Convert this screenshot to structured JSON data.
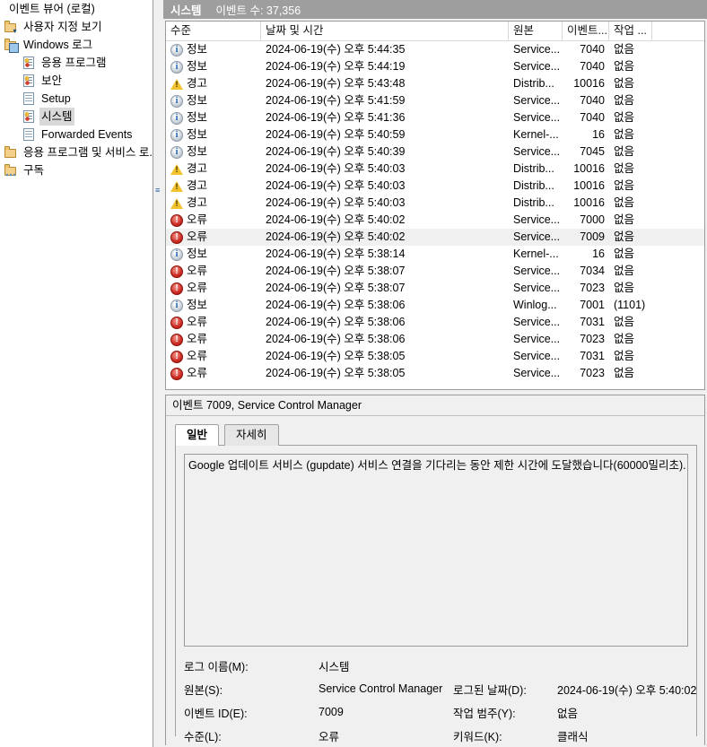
{
  "tree": {
    "items": [
      {
        "label": "이벤트 뷰어 (로컬)",
        "icon": "root-icon",
        "indent": 0,
        "selected": false
      },
      {
        "label": "사용자 지정 보기",
        "icon": "custom-views-icon",
        "indent": 1,
        "selected": false
      },
      {
        "label": "Windows 로그",
        "icon": "windows-logs-icon",
        "indent": 1,
        "selected": false
      },
      {
        "label": "응용 프로그램",
        "icon": "log-alert-icon",
        "indent": 2,
        "selected": false
      },
      {
        "label": "보안",
        "icon": "log-alert-icon",
        "indent": 2,
        "selected": false
      },
      {
        "label": "Setup",
        "icon": "log-icon",
        "indent": 2,
        "selected": false
      },
      {
        "label": "시스템",
        "icon": "log-alert-icon",
        "indent": 2,
        "selected": true
      },
      {
        "label": "Forwarded Events",
        "icon": "log-icon",
        "indent": 2,
        "selected": false
      },
      {
        "label": "응용 프로그램 및 서비스 로.",
        "icon": "app-services-logs-icon",
        "indent": 1,
        "selected": false
      },
      {
        "label": "구독",
        "icon": "subscriptions-icon",
        "indent": 1,
        "selected": false
      }
    ]
  },
  "list": {
    "title": "시스템",
    "count_label": "이벤트 수: 37,356",
    "columns": [
      "수준",
      "날짜 및 시간",
      "원본",
      "이벤트...",
      "작업 ...",
      ""
    ],
    "rows": [
      {
        "level": "정보",
        "level_icon": "information-icon",
        "datetime": "2024-06-19(수) 오후 5:44:35",
        "source": "Service...",
        "event_id": "7040",
        "task": "없음",
        "selected": false
      },
      {
        "level": "정보",
        "level_icon": "information-icon",
        "datetime": "2024-06-19(수) 오후 5:44:19",
        "source": "Service...",
        "event_id": "7040",
        "task": "없음",
        "selected": false
      },
      {
        "level": "경고",
        "level_icon": "warning-icon",
        "datetime": "2024-06-19(수) 오후 5:43:48",
        "source": "Distrib...",
        "event_id": "10016",
        "task": "없음",
        "selected": false
      },
      {
        "level": "정보",
        "level_icon": "information-icon",
        "datetime": "2024-06-19(수) 오후 5:41:59",
        "source": "Service...",
        "event_id": "7040",
        "task": "없음",
        "selected": false
      },
      {
        "level": "정보",
        "level_icon": "information-icon",
        "datetime": "2024-06-19(수) 오후 5:41:36",
        "source": "Service...",
        "event_id": "7040",
        "task": "없음",
        "selected": false
      },
      {
        "level": "정보",
        "level_icon": "information-icon",
        "datetime": "2024-06-19(수) 오후 5:40:59",
        "source": "Kernel-...",
        "event_id": "16",
        "task": "없음",
        "selected": false
      },
      {
        "level": "정보",
        "level_icon": "information-icon",
        "datetime": "2024-06-19(수) 오후 5:40:39",
        "source": "Service...",
        "event_id": "7045",
        "task": "없음",
        "selected": false
      },
      {
        "level": "경고",
        "level_icon": "warning-icon",
        "datetime": "2024-06-19(수) 오후 5:40:03",
        "source": "Distrib...",
        "event_id": "10016",
        "task": "없음",
        "selected": false
      },
      {
        "level": "경고",
        "level_icon": "warning-icon",
        "datetime": "2024-06-19(수) 오후 5:40:03",
        "source": "Distrib...",
        "event_id": "10016",
        "task": "없음",
        "selected": false
      },
      {
        "level": "경고",
        "level_icon": "warning-icon",
        "datetime": "2024-06-19(수) 오후 5:40:03",
        "source": "Distrib...",
        "event_id": "10016",
        "task": "없음",
        "selected": false
      },
      {
        "level": "오류",
        "level_icon": "error-icon",
        "datetime": "2024-06-19(수) 오후 5:40:02",
        "source": "Service...",
        "event_id": "7000",
        "task": "없음",
        "selected": false
      },
      {
        "level": "오류",
        "level_icon": "error-icon",
        "datetime": "2024-06-19(수) 오후 5:40:02",
        "source": "Service...",
        "event_id": "7009",
        "task": "없음",
        "selected": true
      },
      {
        "level": "정보",
        "level_icon": "information-icon",
        "datetime": "2024-06-19(수) 오후 5:38:14",
        "source": "Kernel-...",
        "event_id": "16",
        "task": "없음",
        "selected": false
      },
      {
        "level": "오류",
        "level_icon": "error-icon",
        "datetime": "2024-06-19(수) 오후 5:38:07",
        "source": "Service...",
        "event_id": "7034",
        "task": "없음",
        "selected": false
      },
      {
        "level": "오류",
        "level_icon": "error-icon",
        "datetime": "2024-06-19(수) 오후 5:38:07",
        "source": "Service...",
        "event_id": "7023",
        "task": "없음",
        "selected": false
      },
      {
        "level": "정보",
        "level_icon": "information-icon",
        "datetime": "2024-06-19(수) 오후 5:38:06",
        "source": "Winlog...",
        "event_id": "7001",
        "task": "(1101)",
        "selected": false
      },
      {
        "level": "오류",
        "level_icon": "error-icon",
        "datetime": "2024-06-19(수) 오후 5:38:06",
        "source": "Service...",
        "event_id": "7031",
        "task": "없음",
        "selected": false
      },
      {
        "level": "오류",
        "level_icon": "error-icon",
        "datetime": "2024-06-19(수) 오후 5:38:06",
        "source": "Service...",
        "event_id": "7023",
        "task": "없음",
        "selected": false
      },
      {
        "level": "오류",
        "level_icon": "error-icon",
        "datetime": "2024-06-19(수) 오후 5:38:05",
        "source": "Service...",
        "event_id": "7031",
        "task": "없음",
        "selected": false
      },
      {
        "level": "오류",
        "level_icon": "error-icon",
        "datetime": "2024-06-19(수) 오후 5:38:05",
        "source": "Service...",
        "event_id": "7023",
        "task": "없음",
        "selected": false
      }
    ]
  },
  "detail": {
    "header": "이벤트 7009, Service Control Manager",
    "tabs": [
      {
        "label": "일반",
        "active": true
      },
      {
        "label": "자세히",
        "active": false
      }
    ],
    "message": "Google 업데이트 서비스 (gupdate) 서비스 연결을 기다리는 동안 제한 시간에 도달했습니다(60000밀리초).",
    "properties": [
      {
        "label1": "로그 이름(M):",
        "value1": "시스템",
        "label2": "",
        "value2": ""
      },
      {
        "label1": "원본(S):",
        "value1": "Service Control Manager",
        "label2": "로그된 날짜(D):",
        "value2": "2024-06-19(수) 오후 5:40:02"
      },
      {
        "label1": "이벤트 ID(E):",
        "value1": "7009",
        "label2": "작업 범주(Y):",
        "value2": "없음"
      },
      {
        "label1": "수준(L):",
        "value1": "오류",
        "label2": "키워드(K):",
        "value2": "클래식"
      }
    ]
  },
  "colors": {
    "title_band": "#9e9e9e",
    "selection": "#f0f0f0",
    "error": "#cc2a22",
    "warning": "#f2c32c",
    "information": "#1a5fae"
  }
}
